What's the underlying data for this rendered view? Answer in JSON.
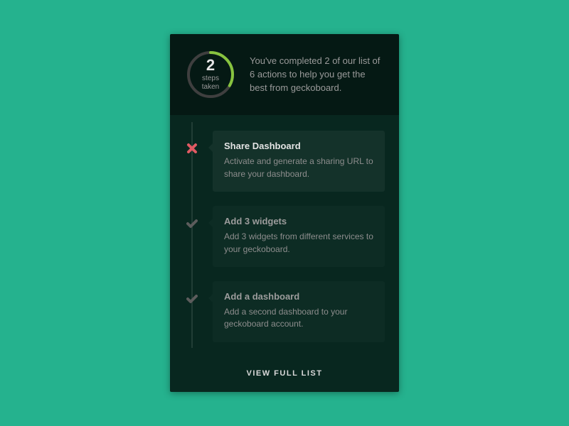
{
  "progress": {
    "completed": 2,
    "total": 6,
    "count_label": "2",
    "sub_label": "steps\ntaken",
    "ring_track_color": "#3f3f3f",
    "ring_fill_color": "#87c33f"
  },
  "summary": "You've completed 2 of our list of 6 actions to help you get the best from geckoboard.",
  "steps": [
    {
      "status": "incomplete",
      "title": "Share Dashboard",
      "desc": "Activate and generate a sharing URL to share your dashboard."
    },
    {
      "status": "done",
      "title": "Add 3 widgets",
      "desc": "Add 3 widgets from different services to your geckoboard."
    },
    {
      "status": "done",
      "title": "Add a dashboard",
      "desc": "Add a second dashboard to your geckoboard account."
    }
  ],
  "footer_link": "VIEW FULL LIST",
  "icons": {
    "incomplete_color": "#e05a63",
    "done_color": "#5c5c5c"
  }
}
